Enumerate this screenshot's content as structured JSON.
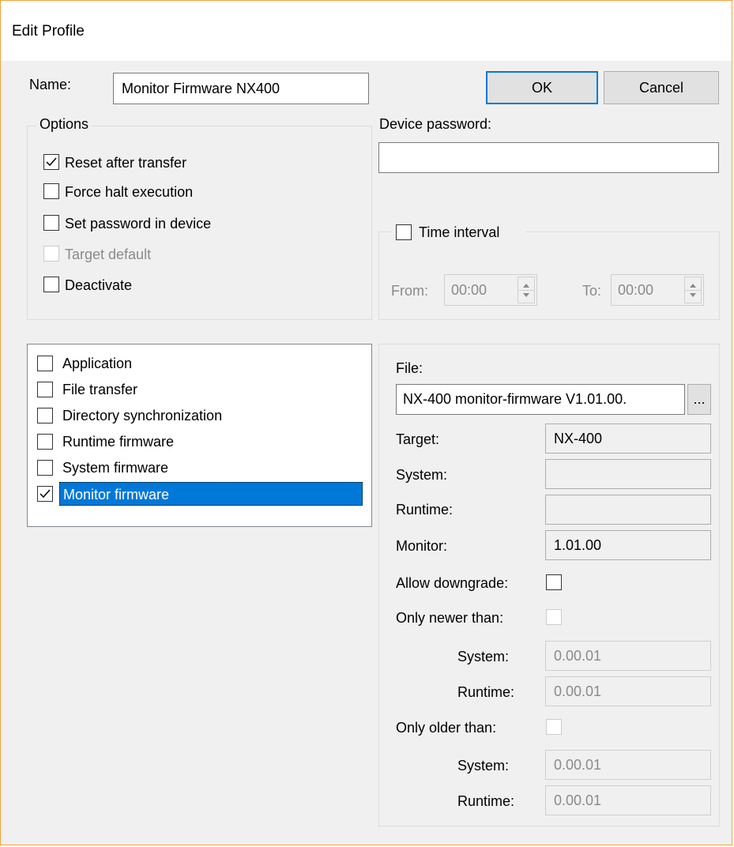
{
  "window": {
    "title": "Edit Profile"
  },
  "name_field": {
    "label": "Name:",
    "value": "Monitor Firmware NX400"
  },
  "buttons": {
    "ok": "OK",
    "cancel": "Cancel"
  },
  "options": {
    "title": "Options",
    "items": [
      {
        "label": "Reset after transfer",
        "checked": true,
        "enabled": true
      },
      {
        "label": "Force halt execution",
        "checked": false,
        "enabled": true
      },
      {
        "label": "Set password in device",
        "checked": false,
        "enabled": true
      },
      {
        "label": "Target default",
        "checked": false,
        "enabled": false
      },
      {
        "label": "Deactivate",
        "checked": false,
        "enabled": true
      }
    ]
  },
  "device_password": {
    "label": "Device password:",
    "value": ""
  },
  "time_interval": {
    "label": "Time interval",
    "checked": false,
    "from_label": "From:",
    "from_value": "00:00",
    "to_label": "To:",
    "to_value": "00:00"
  },
  "transfer_list": {
    "items": [
      {
        "label": "Application",
        "checked": false,
        "selected": false
      },
      {
        "label": "File transfer",
        "checked": false,
        "selected": false
      },
      {
        "label": "Directory synchronization",
        "checked": false,
        "selected": false
      },
      {
        "label": "Runtime firmware",
        "checked": false,
        "selected": false
      },
      {
        "label": "System firmware",
        "checked": false,
        "selected": false
      },
      {
        "label": "Monitor firmware",
        "checked": true,
        "selected": true
      }
    ]
  },
  "details": {
    "file_label": "File:",
    "file_value": "NX-400 monitor-firmware V1.01.00.",
    "browse_label": "...",
    "target_label": "Target:",
    "target_value": "NX-400",
    "system_label": "System:",
    "system_value": "",
    "runtime_label": "Runtime:",
    "runtime_value": "",
    "monitor_label": "Monitor:",
    "monitor_value": "1.01.00",
    "allow_downgrade_label": "Allow downgrade:",
    "allow_downgrade_checked": false,
    "only_newer_label": "Only newer than:",
    "only_newer_checked": false,
    "newer_system_label": "System:",
    "newer_system_value": "0.00.01",
    "newer_runtime_label": "Runtime:",
    "newer_runtime_value": "0.00.01",
    "only_older_label": "Only older than:",
    "only_older_checked": false,
    "older_system_label": "System:",
    "older_system_value": "0.00.01",
    "older_runtime_label": "Runtime:",
    "older_runtime_value": "0.00.01"
  }
}
